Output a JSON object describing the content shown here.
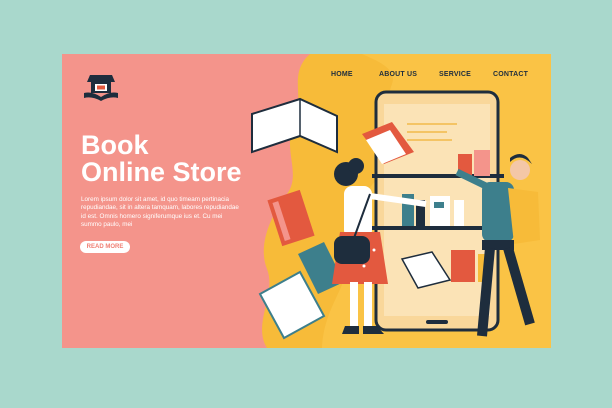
{
  "nav": {
    "items": [
      "HOME",
      "ABOUT US",
      "SERVICE",
      "CONTACT"
    ]
  },
  "hero": {
    "title_line1": "Book",
    "title_line2": "Online Store",
    "description": "Lorem ipsum dolor sit amet, id quo timeam pertinacia repudiandae, sit in altera tamquam, labores repudiandae id est. Omnis homero signiferumque ius et. Cu mei summo paulo, mei",
    "cta_label": "READ MORE"
  },
  "icons": {
    "logo": "store-logo-icon"
  },
  "colors": {
    "page_background": "#a9d8cc",
    "hero_background": "#f4948b",
    "accent_yellow": "#f7bb39",
    "navy": "#1e2d3d",
    "button_text": "#f07f73"
  }
}
